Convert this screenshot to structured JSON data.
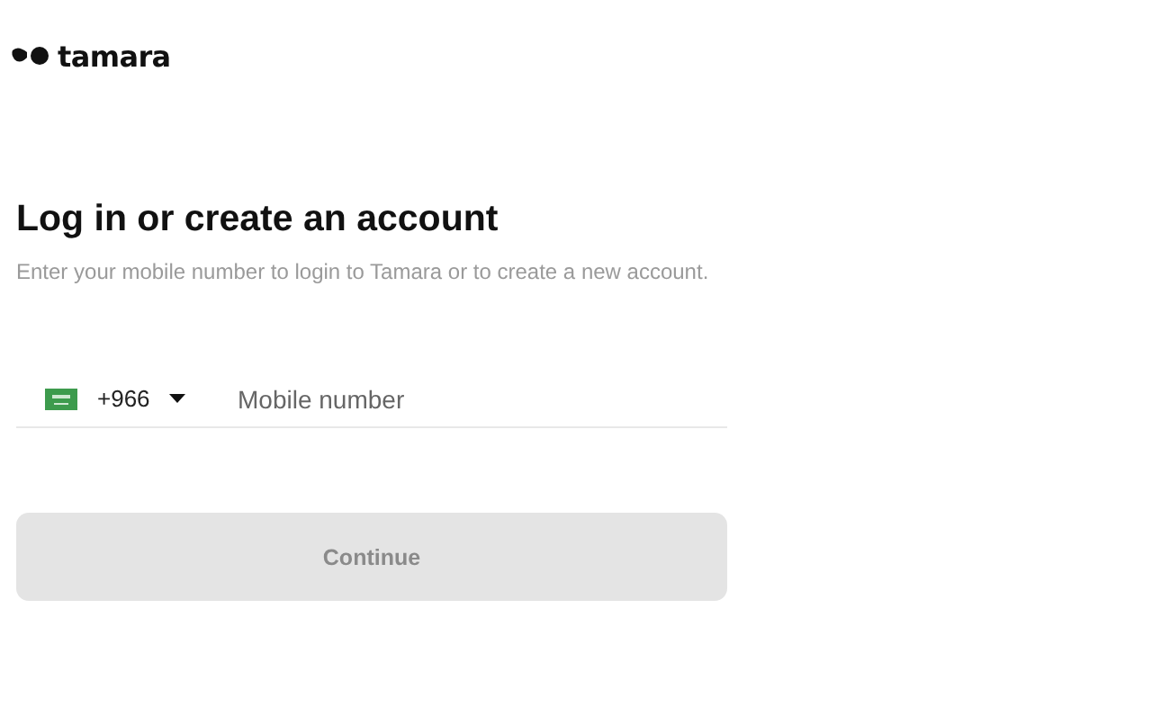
{
  "logo": {
    "wordmark": "tamara"
  },
  "heading": "Log in or create an account",
  "subtitle": "Enter your mobile number to login to Tamara or to create a new account.",
  "phone": {
    "country_code": "+966",
    "placeholder": "Mobile number"
  },
  "continue_button": {
    "label": "Continue",
    "disabled": true
  }
}
